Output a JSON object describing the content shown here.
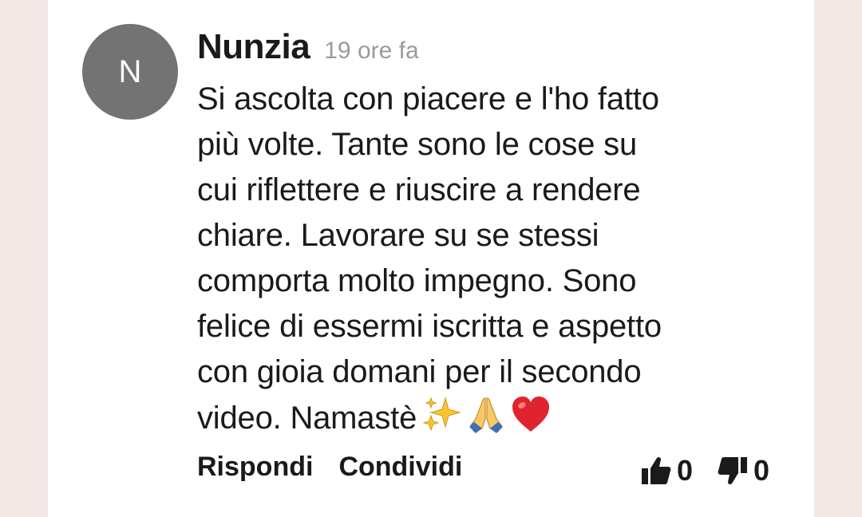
{
  "comment": {
    "avatar_letter": "N",
    "author": "Nunzia",
    "time": "19 ore fa",
    "text": "Si ascolta con piacere e l'ho fatto\npiù volte. Tante sono le cose su\ncui riflettere e riuscire a rendere\nchiare. Lavorare su se stessi\ncomporta molto impegno. Sono\nfelice di essermi iscritta e aspetto\ncon gioia domani per il secondo\nvideo. Namastè",
    "emojis": [
      "sparkles-icon",
      "folded-hands-icon",
      "red-heart-icon"
    ]
  },
  "actions": {
    "reply_label": "Rispondi",
    "share_label": "Condividi"
  },
  "votes": {
    "likes": "0",
    "dislikes": "0"
  },
  "colors": {
    "background": "#f4e8e6",
    "card": "#ffffff",
    "avatar": "#737373",
    "text": "#1a1a1a",
    "muted": "#9b9b9b",
    "heart": "#e0242f",
    "sparkles": "#f7c531"
  }
}
